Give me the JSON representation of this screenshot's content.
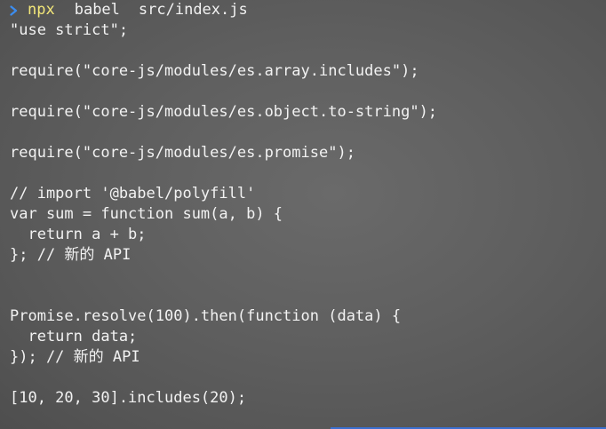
{
  "prompt": {
    "icon": "chevron-right-icon",
    "command": "npx",
    "args": [
      "babel",
      "src/index.js"
    ]
  },
  "output": [
    "\"use strict\";",
    "",
    "require(\"core-js/modules/es.array.includes\");",
    "",
    "require(\"core-js/modules/es.object.to-string\");",
    "",
    "require(\"core-js/modules/es.promise\");",
    "",
    "// import '@babel/polyfill'",
    "var sum = function sum(a, b) {",
    "  return a + b;",
    "}; // 新的 API",
    "",
    "",
    "Promise.resolve(100).then(function (data) {",
    "  return data;",
    "}); // 新的 API",
    "",
    "[10, 20, 30].includes(20);"
  ],
  "colors": {
    "prompt_chevron": "#3c8df0",
    "command": "#f3e779",
    "text": "#f2f2f2"
  }
}
